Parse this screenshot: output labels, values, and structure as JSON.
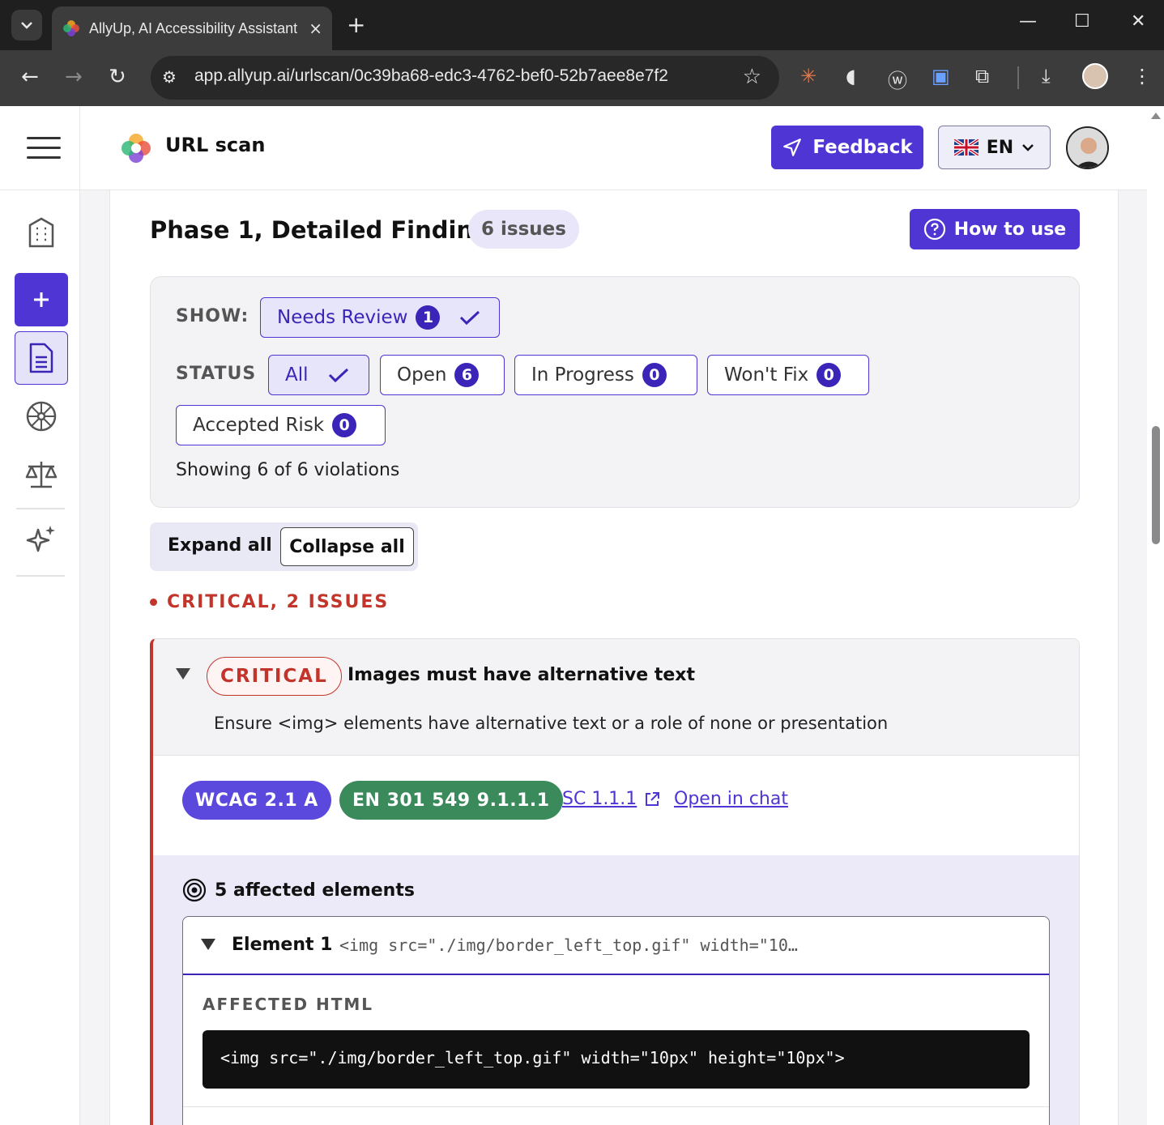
{
  "browser": {
    "tab_title": "AllyUp, AI Accessibility Assistant",
    "url": "app.allyup.ai/urlscan/0c39ba68-edc3-4762-bef0-52b7aee8e7f2",
    "new_tab": "+",
    "close_tab": "×"
  },
  "header": {
    "title": "URL scan",
    "feedback_label": "Feedback",
    "language": "EN"
  },
  "sidebar": {
    "items": [
      {
        "name": "building-icon"
      },
      {
        "name": "plus-icon"
      },
      {
        "name": "document-icon"
      },
      {
        "name": "wheel-icon"
      },
      {
        "name": "scales-icon"
      },
      {
        "name": "sparkles-icon"
      }
    ]
  },
  "findings": {
    "title": "Phase 1, Detailed Findings",
    "issue_count": "6 issues",
    "how_to_use": "How to use",
    "show_label": "SHOW:",
    "needs_review": {
      "label": "Needs Review",
      "count": "1"
    },
    "status_label": "STATUS",
    "statuses": [
      {
        "label": "All",
        "count": null,
        "active": true
      },
      {
        "label": "Open",
        "count": "6"
      },
      {
        "label": "In Progress",
        "count": "0"
      },
      {
        "label": "Won't Fix",
        "count": "0"
      },
      {
        "label": "Accepted Risk",
        "count": "0"
      }
    ],
    "showing": "Showing 6 of 6 violations",
    "expand_all": "Expand all",
    "collapse_all": "Collapse all",
    "severity_heading": "CRITICAL, 2 ISSUES"
  },
  "issue": {
    "severity": "CRITICAL",
    "title": "Images must have alternative text",
    "description": "Ensure <img> elements have alternative text or a role of none or presentation",
    "tag_wcag": "WCAG 2.1 A",
    "tag_en": "EN 301 549 9.1.1.1",
    "link_sc": "SC 1.1.1",
    "link_chat": "Open in chat",
    "affected_title": "5 affected elements",
    "element": {
      "label": "Element 1",
      "code_preview": "<img src=\"./img/border_left_top.gif\" width=\"10…",
      "affected_html_label": "AFFECTED HTML",
      "code": "<img src=\"./img/border_left_top.gif\" width=\"10px\" height=\"10px\">"
    }
  },
  "colors": {
    "accent": "#4f35d3",
    "critical": "#c2352b",
    "en_tag": "#3a8a5c"
  }
}
